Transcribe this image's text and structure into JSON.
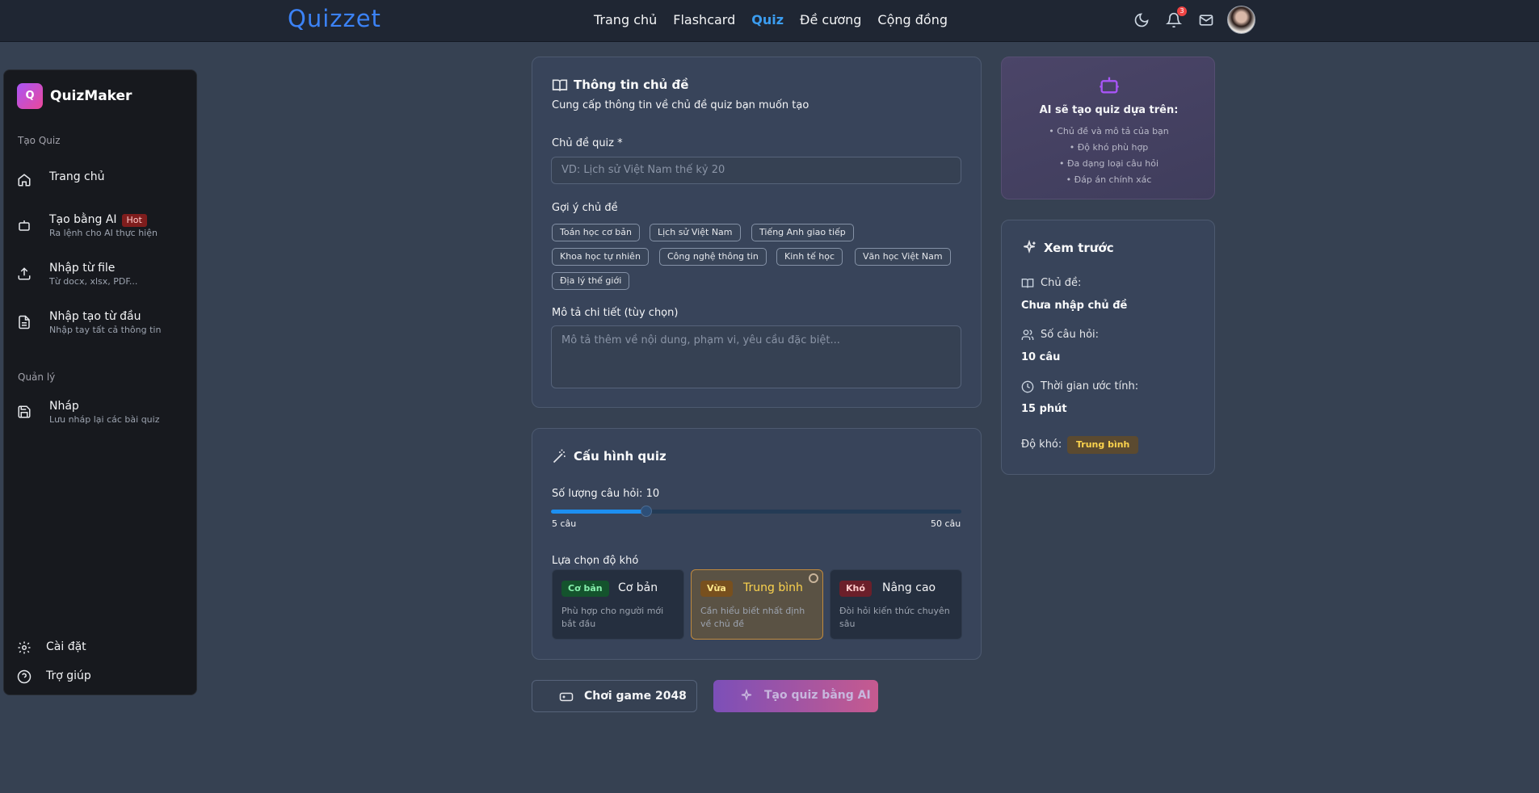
{
  "app": {
    "logo": "Quizzet"
  },
  "nav": {
    "items": [
      "Trang chủ",
      "Flashcard",
      "Quiz",
      "Đề cương",
      "Cộng đồng"
    ],
    "active": "Quiz"
  },
  "notifications": {
    "count": "3"
  },
  "sidebar": {
    "brand": {
      "initial": "Q",
      "name": "QuizMaker"
    },
    "section_create": "Tạo Quiz",
    "items": [
      {
        "title": "Trang chủ",
        "sub": "",
        "icon": "home-icon"
      },
      {
        "title": "Tạo bằng AI",
        "sub": "Ra lệnh cho AI thực hiện",
        "badge": "Hot",
        "icon": "robot-icon"
      },
      {
        "title": "Nhập từ file",
        "sub": "Từ docx, xlsx, PDF...",
        "icon": "upload-icon"
      },
      {
        "title": "Nhập tạo từ đầu",
        "sub": "Nhập tay tất cả thông tin",
        "icon": "file-icon"
      }
    ],
    "section_manage": "Quản lý",
    "manage_items": [
      {
        "title": "Nháp",
        "sub": "Lưu nháp lại các bài quiz",
        "icon": "save-icon"
      }
    ],
    "bottom": {
      "settings": "Cài đặt",
      "help": "Trợ giúp"
    }
  },
  "topic_card": {
    "title": "Thông tin chủ đề",
    "subtitle": "Cung cấp thông tin về chủ đề quiz bạn muốn tạo",
    "topic_label": "Chủ đề quiz *",
    "topic_placeholder": "VD: Lịch sử Việt Nam thế kỷ 20",
    "suggest_label": "Gợi ý chủ đề",
    "suggestions": [
      "Toán học cơ bản",
      "Lịch sử Việt Nam",
      "Tiếng Anh giao tiếp",
      "Khoa học tự nhiên",
      "Công nghệ thông tin",
      "Kinh tế học",
      "Văn học Việt Nam",
      "Địa lý thế giới"
    ],
    "desc_label": "Mô tả chi tiết (tùy chọn)",
    "desc_placeholder": "Mô tả thêm về nội dung, phạm vi, yêu cầu đặc biệt..."
  },
  "config_card": {
    "title": "Cấu hình quiz",
    "count_label": "Số lượng câu hỏi: 10",
    "count_value": 10,
    "count_min": 5,
    "count_max": 50,
    "min_label": "5 câu",
    "max_label": "50 câu",
    "difficulty_label": "Lựa chọn độ khó",
    "difficulties": [
      {
        "tag": "Cơ bản",
        "name": "Cơ bản",
        "desc": "Phù hợp cho người mới bắt đầu",
        "tag_bg": "#14532d",
        "tag_color": "#86efac",
        "name_color": "#f3f4f6"
      },
      {
        "tag": "Vừa",
        "name": "Trung bình",
        "desc": "Cần hiểu biết nhất định về chủ đề",
        "tag_bg": "#78501e",
        "tag_color": "#fde68a",
        "name_color": "#fcd34d"
      },
      {
        "tag": "Khó",
        "name": "Nâng cao",
        "desc": "Đòi hỏi kiến thức chuyên sâu",
        "tag_bg": "#6b1f2a",
        "tag_color": "#fecaca",
        "name_color": "#f3f4f6"
      }
    ],
    "selected": "Trung bình"
  },
  "buttons": {
    "game": "Chơi game 2048",
    "ai": "Tạo quiz bằng AI"
  },
  "ai_info": {
    "title": "AI sẽ tạo quiz dựa trên:",
    "points": [
      "• Chủ đề và mô tả của bạn",
      "• Độ khó phù hợp",
      "• Đa dạng loại câu hỏi",
      "• Đáp án chính xác"
    ]
  },
  "preview": {
    "title": "Xem trước",
    "topic_label": "Chủ đề:",
    "topic_value": "Chưa nhập chủ đề",
    "count_label": "Số câu hỏi:",
    "count_value": "10 câu",
    "time_label": "Thời gian ước tính:",
    "time_value": "15 phút",
    "difficulty_label": "Độ khó:",
    "difficulty_value": "Trung bình"
  },
  "colors": {
    "accent": "#3b9df0",
    "page_bg": "#364152",
    "card_bg": "#38445a"
  }
}
